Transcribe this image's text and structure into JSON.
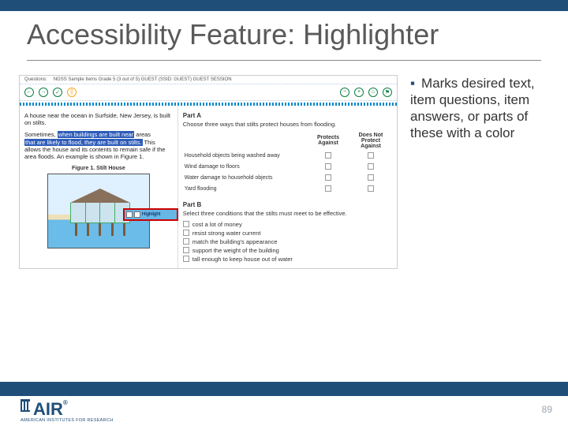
{
  "slide": {
    "title": "Accessibility Feature: Highlighter",
    "bullet": "Marks desired text, item questions, item answers, or parts of these with a color",
    "page_number": "89"
  },
  "logo": {
    "text": "AIR",
    "reg": "®",
    "subtitle": "AMERICAN INSTITUTES FOR RESEARCH"
  },
  "screenshot": {
    "quiz_label": "Questions:",
    "breadcrumb": "NGSS Sample Items Grade 5 (3 out of 5)   GUEST (SSID: GUEST)   GUEST SESSION",
    "toolbar": {
      "back": "←",
      "fwd": "→",
      "save": "✓",
      "pause": "||",
      "zoom_in": "+",
      "zoom_out": "−",
      "tool1": "⌂",
      "tool2": "⚑"
    },
    "passage": {
      "p1": "A house near the ocean in Surfside, New Jersey, is built on stilts.",
      "p2a": "Sometimes,",
      "p2_hl1": "when buildings are built near",
      "p2_br": "areas",
      "p2_hl2": "that are likely to flood, they are built on stilts.",
      "p2b": "This allows the house and its contents to remain safe if the area floods. An example is shown in Figure 1.",
      "fig_caption": "Figure 1. Stilt House"
    },
    "context_menu": {
      "label": "Highlight"
    },
    "partA": {
      "label": "Part A",
      "question": "Choose three ways that stilts protect houses from flooding.",
      "col_protects": "Protects Against",
      "col_not": "Does Not Protect Against",
      "rows": [
        "Household objects being washed away",
        "Wind damage to floors",
        "Water damage to household objects",
        "Yard flooding"
      ]
    },
    "partB": {
      "label": "Part B",
      "question": "Select three conditions that the stilts must meet to be effective.",
      "options": [
        "cost a lot of money",
        "resist strong water current",
        "match the building's appearance",
        "support the weight of the building",
        "tall enough to keep house out of water"
      ]
    }
  }
}
